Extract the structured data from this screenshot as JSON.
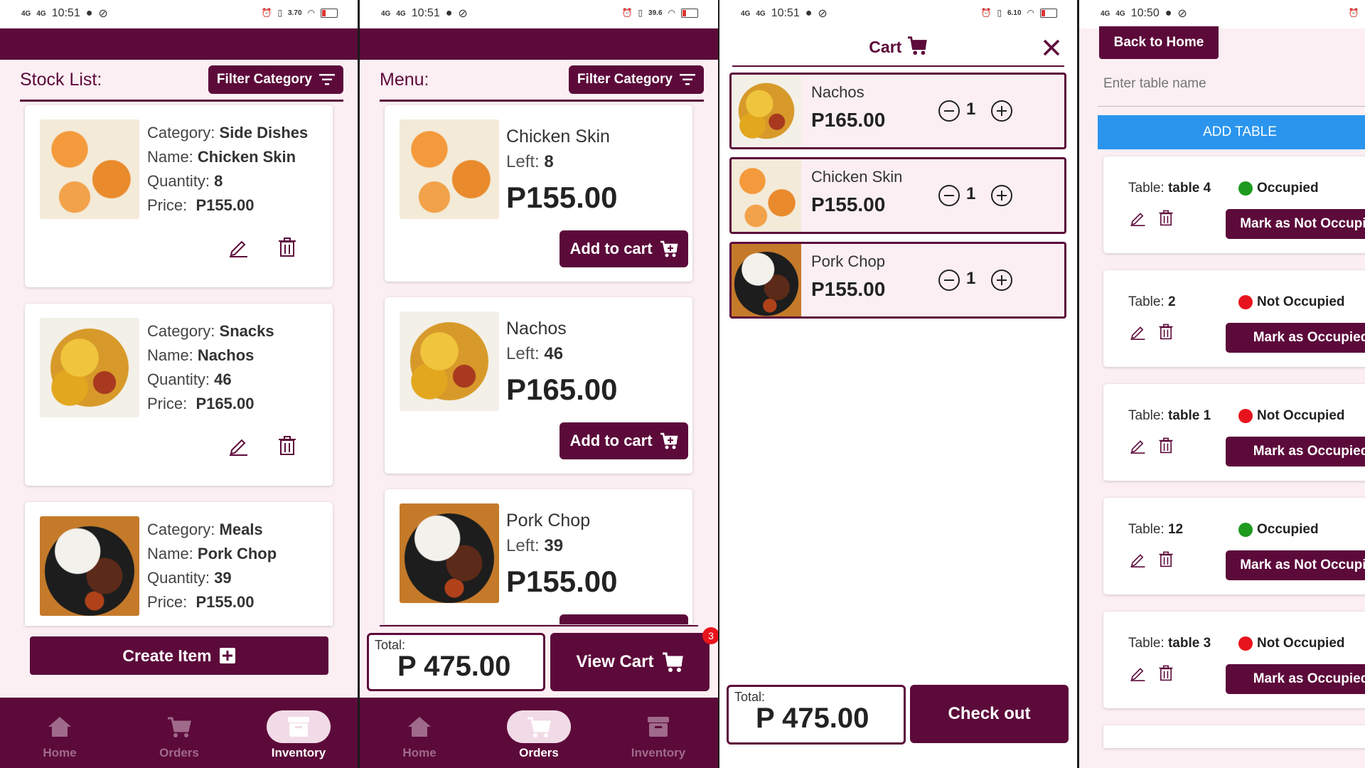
{
  "colors": {
    "brand": "#5c0a3a",
    "accent_blue": "#2b95ee",
    "occupied": "#1e9a1e",
    "not_occupied": "#e8141d",
    "badge": "#e8141d"
  },
  "status": {
    "p1_time": "10:51",
    "p2_time": "10:51",
    "p3_time": "10:51",
    "p4_time": "10:50",
    "net": "4G",
    "p1_speed": "3.70",
    "p2_speed": "39.6",
    "p3_speed": "6.10"
  },
  "stock": {
    "title": "Stock List:",
    "filter_label": "Filter Category",
    "field_category": "Category:",
    "field_name": "Name:",
    "field_quantity": "Quantity:",
    "field_price": "Price:",
    "items": [
      {
        "category": "Side Dishes",
        "name": "Chicken Skin",
        "quantity": "8",
        "price": "P155.00",
        "image": "chicken-skin"
      },
      {
        "category": "Snacks",
        "name": "Nachos",
        "quantity": "46",
        "price": "P165.00",
        "image": "nachos"
      },
      {
        "category": "Meals",
        "name": "Pork Chop",
        "quantity": "39",
        "price": "P155.00",
        "image": "pork-chop"
      }
    ],
    "create_label": "Create Item"
  },
  "menu": {
    "title": "Menu:",
    "filter_label": "Filter Category",
    "left_label": "Left:",
    "add_label": "Add to cart",
    "items": [
      {
        "name": "Chicken Skin",
        "left": "8",
        "price": "P155.00"
      },
      {
        "name": "Nachos",
        "left": "46",
        "price": "P165.00"
      },
      {
        "name": "Pork Chop",
        "left": "39",
        "price": "P155.00"
      }
    ],
    "total_label": "Total:",
    "total_value": "P 475.00",
    "view_cart_label": "View Cart",
    "cart_count": "3"
  },
  "nav": {
    "home": "Home",
    "orders": "Orders",
    "inventory": "Inventory"
  },
  "cart": {
    "title": "Cart",
    "items": [
      {
        "name": "Nachos",
        "price": "P165.00",
        "qty": "1"
      },
      {
        "name": "Chicken Skin",
        "price": "P155.00",
        "qty": "1"
      },
      {
        "name": "Pork Chop",
        "price": "P155.00",
        "qty": "1"
      }
    ],
    "total_label": "Total:",
    "total_value": "P 475.00",
    "checkout_label": "Check out"
  },
  "tables": {
    "back_label": "Back to Home",
    "input_placeholder": "Enter table name",
    "add_label": "ADD TABLE",
    "table_prefix": "Table:",
    "items": [
      {
        "name": "table 4",
        "status": "Occupied",
        "action": "Mark as Not Occupied"
      },
      {
        "name": "2",
        "status": "Not Occupied",
        "action": "Mark as Occupied"
      },
      {
        "name": "table 1",
        "status": "Not Occupied",
        "action": "Mark as Occupied"
      },
      {
        "name": "12",
        "status": "Occupied",
        "action": "Mark as Not Occupied"
      },
      {
        "name": "table 3",
        "status": "Not Occupied",
        "action": "Mark as Occupied"
      }
    ]
  }
}
